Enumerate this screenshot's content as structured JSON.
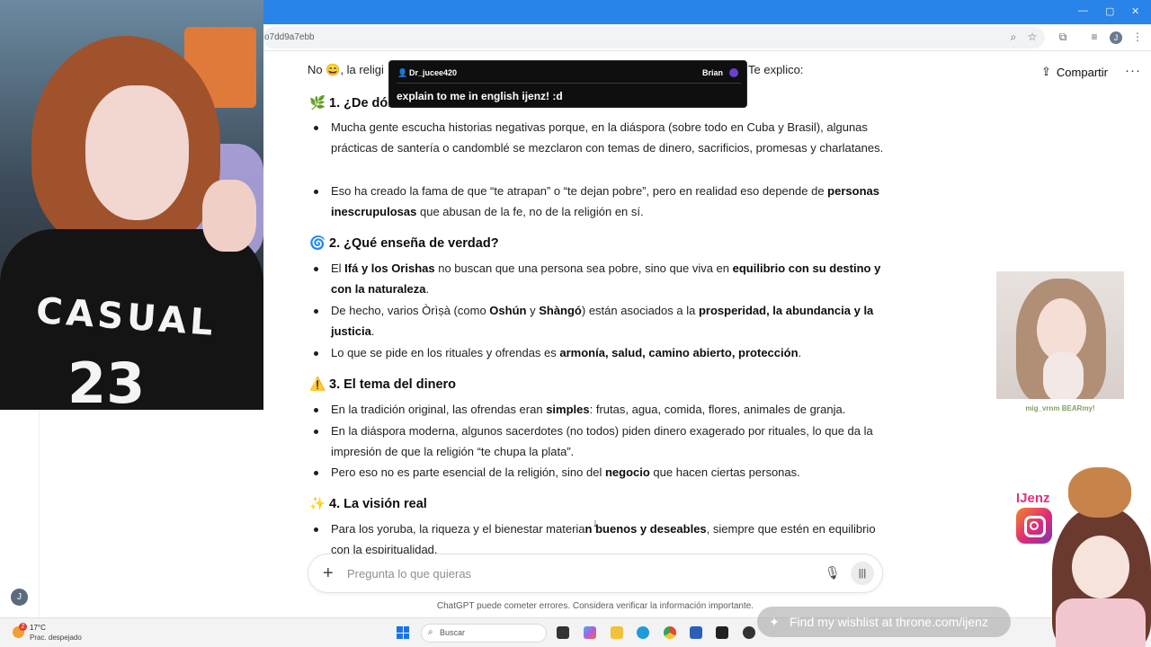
{
  "browser": {
    "url_fragment": "o7dd9a7ebb",
    "profile_initial": "J"
  },
  "header": {
    "share_label": "Compartir",
    "more_label": "···"
  },
  "sidebar": {
    "user_initial": "J"
  },
  "message": {
    "intro_start": "No",
    "intro_mid": ", la religi",
    "intro_end": "Te explico:",
    "sections": [
      {
        "icon": "🌿",
        "title": "1. ¿De dón",
        "bullets": [
          [
            {
              "text": "Mucha gente escucha historias negativas porque, en la diáspora (sobre todo en Cuba y Brasil), algunas prácticas de santería o candomblé se mezclaron con temas de dinero, sacrificios, promesas y charlatanes."
            }
          ],
          [
            {
              "text": "Eso ha creado la fama de que “te atrapan” o “te dejan pobre”, pero en realidad eso depende de "
            },
            {
              "text": "personas inescrupulosas",
              "bold": true
            },
            {
              "text": " que abusan de la fe, no de la religión en sí."
            }
          ]
        ]
      },
      {
        "icon": "🌀",
        "title": "2. ¿Qué enseña de verdad?",
        "bullets": [
          [
            {
              "text": "El "
            },
            {
              "text": "Ifá y los Orishas",
              "bold": true
            },
            {
              "text": " no buscan que una persona sea pobre, sino que viva en "
            },
            {
              "text": "equilibrio con su destino y con la naturaleza",
              "bold": true
            },
            {
              "text": "."
            }
          ],
          [
            {
              "text": "De hecho, varios Òrìṣà (como "
            },
            {
              "text": "Oshún",
              "bold": true
            },
            {
              "text": " y "
            },
            {
              "text": "Shàngó",
              "bold": true
            },
            {
              "text": ") están asociados a la "
            },
            {
              "text": "prosperidad, la abundancia y la justicia",
              "bold": true
            },
            {
              "text": "."
            }
          ],
          [
            {
              "text": "Lo que se pide en los rituales y ofrendas es "
            },
            {
              "text": "armonía, salud, camino abierto, protección",
              "bold": true
            },
            {
              "text": "."
            }
          ]
        ]
      },
      {
        "icon": "⚠️",
        "title": "3. El tema del dinero",
        "bullets": [
          [
            {
              "text": "En la tradición original, las ofrendas eran "
            },
            {
              "text": "simples",
              "bold": true
            },
            {
              "text": ": frutas, agua, comida, flores, animales de granja."
            }
          ],
          [
            {
              "text": "En la diáspora moderna, algunos sacerdotes (no todos) piden dinero exagerado por rituales, lo que da la impresión de que la religión “te chupa la plata”."
            }
          ],
          [
            {
              "text": "Pero eso no es parte esencial de la religión, sino del "
            },
            {
              "text": "negocio",
              "bold": true
            },
            {
              "text": " que hacen ciertas personas."
            }
          ]
        ]
      },
      {
        "icon": "✨",
        "title": "4. La visión real",
        "bullets": [
          [
            {
              "text": "Para los yoruba, la riqueza y el bienestar materia"
            },
            {
              "text": "n buenos y deseables",
              "bold": true
            },
            {
              "text": ", siempre que estén en equilibrio con la espiritualidad."
            }
          ]
        ]
      }
    ]
  },
  "composer": {
    "placeholder": "Pregunta lo que quieras",
    "plus": "+",
    "disclaimer": "ChatGPT puede cometer errores. Considera verificar la información importante."
  },
  "taskbar": {
    "weather_badge": "2",
    "temperature": "17°C",
    "weather_desc": "Prac. despejado",
    "search_label": "Buscar"
  },
  "overlay": {
    "chat_user": "Dr_jucee420",
    "chat_channel": "Brian",
    "chat_message": "explain to me in english ijenz! :d",
    "shirt_text": "CASUAL",
    "shirt_number": "23",
    "cam_caption": "mig_vrnm BEARmy!",
    "brand_name": "IJenz",
    "wishlist": "Find my wishlist at throne.com/ijenz"
  }
}
